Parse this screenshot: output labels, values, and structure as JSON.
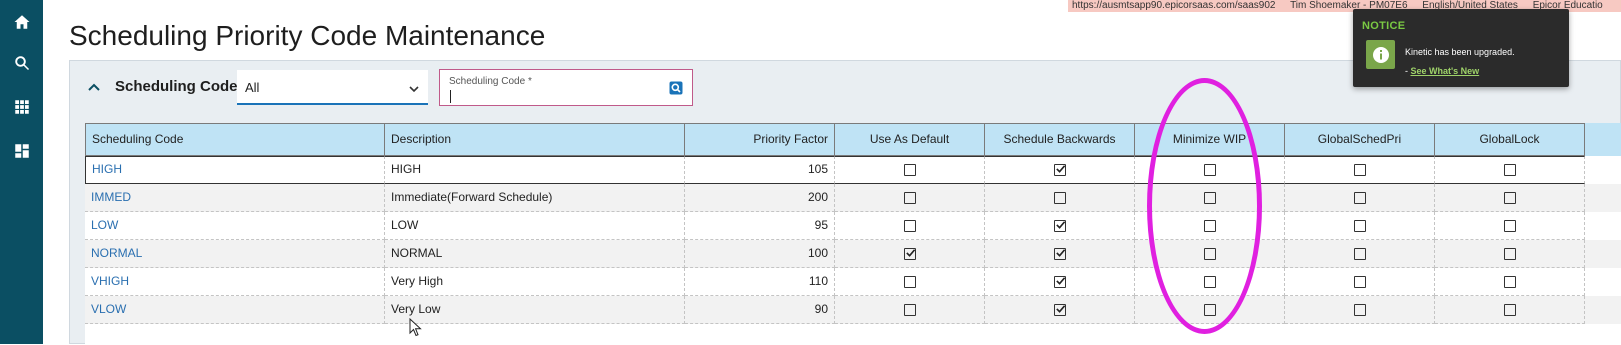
{
  "sidebar": {
    "items": [
      {
        "icon": "home-icon",
        "name": "sidebar-home"
      },
      {
        "icon": "search-icon",
        "name": "sidebar-search"
      },
      {
        "icon": "apps-grid-icon",
        "name": "sidebar-apps"
      },
      {
        "icon": "dashboard-icon",
        "name": "sidebar-dashboard"
      }
    ],
    "color": "#0b4f63"
  },
  "status_bar": {
    "url": "https://ausmtsapp90.epicorsaas.com/saas902",
    "user": "Tim Shoemaker - PM07E6",
    "locale": "English/United States",
    "company": "Epicor Educatio"
  },
  "page": {
    "title": "Scheduling Priority Code Maintenance"
  },
  "search": {
    "section_title": "Scheduling Code",
    "filter_value": "All",
    "input_label": "Scheduling Code *",
    "input_value": ""
  },
  "grid": {
    "columns": [
      {
        "label": "Scheduling Code",
        "align": "left"
      },
      {
        "label": "Description",
        "align": "left"
      },
      {
        "label": "Priority Factor",
        "align": "right"
      },
      {
        "label": "Use As Default",
        "align": "center"
      },
      {
        "label": "Schedule Backwards",
        "align": "center"
      },
      {
        "label": "Minimize WIP",
        "align": "center"
      },
      {
        "label": "GlobalSchedPri",
        "align": "center"
      },
      {
        "label": "GlobalLock",
        "align": "center"
      }
    ],
    "rows": [
      {
        "code": "HIGH",
        "description": "HIGH",
        "priority": "105",
        "use_default": false,
        "sched_backwards": true,
        "minimize_wip": false,
        "global_sched_pri": false,
        "global_lock": false
      },
      {
        "code": "IMMED",
        "description": "Immediate(Forward Schedule)",
        "priority": "200",
        "use_default": false,
        "sched_backwards": false,
        "minimize_wip": false,
        "global_sched_pri": false,
        "global_lock": false
      },
      {
        "code": "LOW",
        "description": "LOW",
        "priority": "95",
        "use_default": false,
        "sched_backwards": true,
        "minimize_wip": false,
        "global_sched_pri": false,
        "global_lock": false
      },
      {
        "code": "NORMAL",
        "description": "NORMAL",
        "priority": "100",
        "use_default": true,
        "sched_backwards": true,
        "minimize_wip": false,
        "global_sched_pri": false,
        "global_lock": false
      },
      {
        "code": "VHIGH",
        "description": "Very High",
        "priority": "110",
        "use_default": false,
        "sched_backwards": true,
        "minimize_wip": false,
        "global_sched_pri": false,
        "global_lock": false
      },
      {
        "code": "VLOW",
        "description": "Very Low",
        "priority": "90",
        "use_default": false,
        "sched_backwards": true,
        "minimize_wip": false,
        "global_sched_pri": false,
        "global_lock": false
      }
    ],
    "selected_row": 0,
    "header_color": "#bfe3f5",
    "link_color": "#2a6fb0"
  },
  "notice": {
    "title": "NOTICE",
    "message": "Kinetic has been upgraded.",
    "link_prefix": "- ",
    "link_text": "See What's New",
    "accent_color": "#7ac943"
  },
  "annotation": {
    "shape": "ellipse",
    "color": "#e020e0",
    "highlights": "Minimize WIP"
  }
}
